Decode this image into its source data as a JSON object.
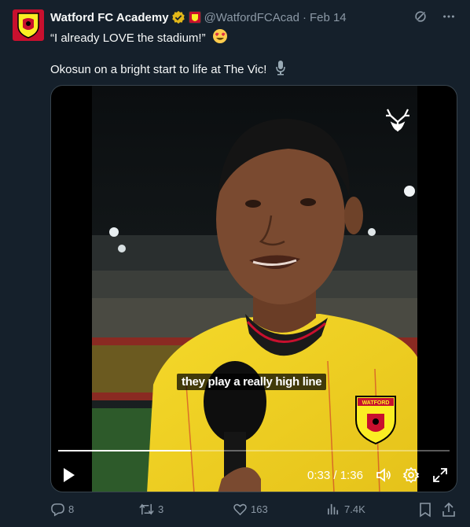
{
  "tweet": {
    "author_name": "Watford FC Academy",
    "handle": "@WatfordFCAcad",
    "separator": "·",
    "date": "Feb 14",
    "line1": "“I already LOVE the stadium!”",
    "line2": "Okosun on a bright start to life at The Vic!"
  },
  "video": {
    "caption": "they play a really high line",
    "current_time": "0:33",
    "duration": "1:36",
    "time_separator": "/",
    "progress": 0.34,
    "crest_text": "WATFORD"
  },
  "actions": {
    "replies": "8",
    "reposts": "3",
    "likes": "163",
    "views": "7.4K"
  },
  "colors": {
    "background": "#15202b",
    "brand_red": "#c8102e",
    "brand_yellow": "#fbee23",
    "muted": "#8b98a5",
    "verified": "#e2b719"
  }
}
